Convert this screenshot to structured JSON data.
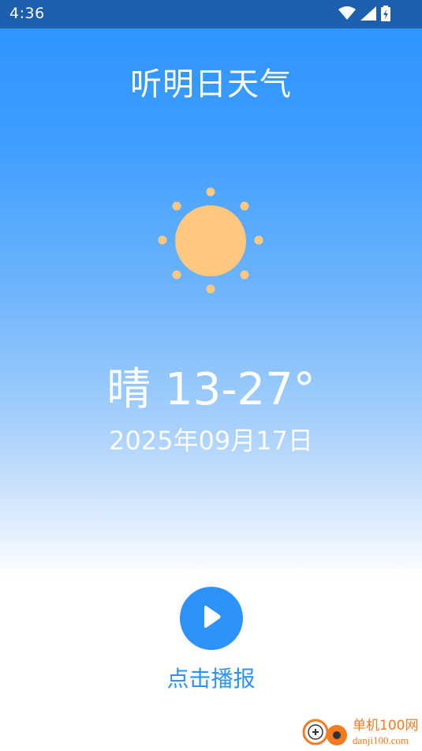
{
  "status_bar": {
    "time": "4:36",
    "icons": [
      "wifi-icon",
      "signal-icon",
      "battery-icon"
    ]
  },
  "app": {
    "title": "听明日天气"
  },
  "weather": {
    "icon": "sun-icon",
    "condition_and_temp": "晴 13-27°",
    "date": "2025年09月17日"
  },
  "actions": {
    "play_label": "点击播报",
    "play_icon": "play-icon"
  },
  "watermark": {
    "name": "单机100网",
    "domain": "danji100.com"
  },
  "colors": {
    "status_bar": "#1b5fae",
    "gradient_top": "#2f95ff",
    "sun": "#ffc77f",
    "accent": "#2d93fb",
    "watermark": "#f47b21"
  }
}
